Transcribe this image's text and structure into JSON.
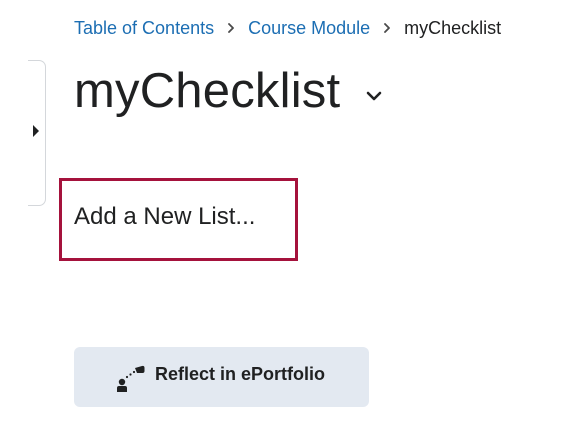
{
  "breadcrumb": {
    "items": [
      {
        "label": "Table of Contents"
      },
      {
        "label": "Course Module"
      }
    ],
    "current": "myChecklist"
  },
  "page": {
    "title": "myChecklist"
  },
  "content": {
    "add_list_label": "Add a New List..."
  },
  "actions": {
    "reflect_label": "Reflect in ePortfolio"
  },
  "colors": {
    "link": "#1c6eb3",
    "highlight_border": "#a5123c",
    "button_bg": "#e3e9f1",
    "text": "#202122"
  },
  "icons": {
    "breadcrumb_separator": "chevron-right-icon",
    "title_menu": "chevron-down-icon",
    "side_toggle": "caret-right-icon",
    "reflect": "eportfolio-icon"
  }
}
